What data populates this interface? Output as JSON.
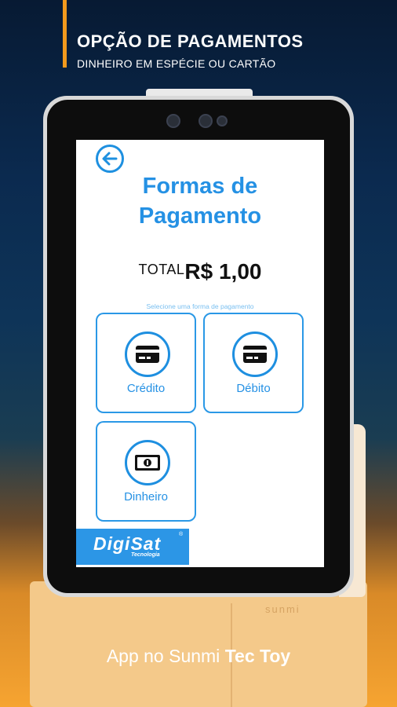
{
  "promo": {
    "headline": "OPÇÃO DE PAGAMENTOS",
    "subheadline": "DINHEIRO EM ESPÉCIE OU CARTÃO",
    "footer_prefix": "App no Sunmi ",
    "footer_brand": "Tec Toy",
    "device_brand": "sunmi"
  },
  "screen": {
    "title_line1": "Formas de",
    "title_line2": "Pagamento",
    "total_label": "TOTAL",
    "total_value": "R$ 1,00",
    "hint": "Selecione uma forma de pagamento",
    "options": [
      {
        "label": "Crédito",
        "icon": "credit-card-icon"
      },
      {
        "label": "Débito",
        "icon": "debit-card-icon"
      },
      {
        "label": "Dinheiro",
        "icon": "cash-icon"
      }
    ],
    "logo": {
      "name": "DigiSat",
      "sub": "Tecnologia",
      "mark": "®"
    }
  },
  "colors": {
    "accent": "#f39a1d",
    "primary_blue": "#2591e4",
    "hint_blue": "#79bff0"
  }
}
